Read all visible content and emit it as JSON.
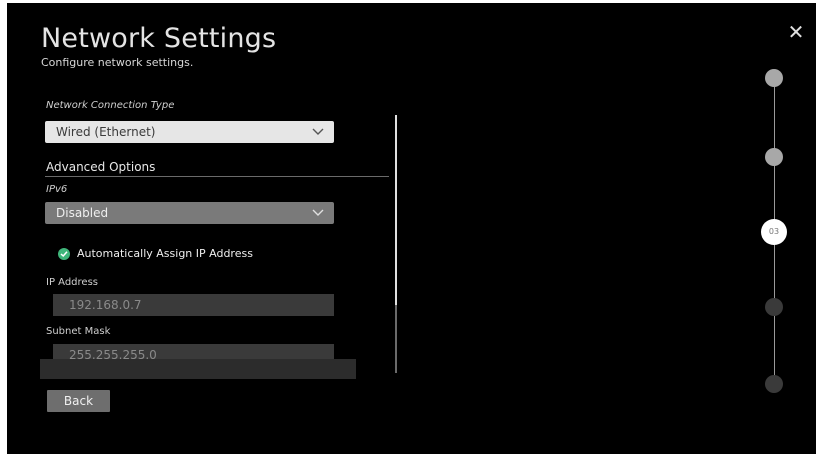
{
  "header": {
    "title": "Network Settings",
    "subtitle": "Configure network settings.",
    "close_icon": "close-icon",
    "close_glyph": "✕"
  },
  "form": {
    "connection_type_label": "Network Connection Type",
    "connection_type_value": "Wired (Ethernet)",
    "advanced_options_label": "Advanced Options",
    "ipv6_label": "IPv6",
    "ipv6_value": "Disabled",
    "auto_assign_label": "Automatically Assign IP Address",
    "ip_address_label": "IP Address",
    "ip_address_value": "192.168.0.7",
    "subnet_mask_label": "Subnet Mask",
    "subnet_mask_value": "255.255.255.0",
    "back_button_label": "Back"
  },
  "stepper": {
    "current_step_label": "03",
    "steps": [
      {
        "state": "done"
      },
      {
        "state": "done"
      },
      {
        "state": "current"
      },
      {
        "state": "future"
      },
      {
        "state": "future"
      }
    ]
  },
  "colors": {
    "background": "#000000",
    "check_green": "#3fb57a",
    "select_light": "#e6e6e6",
    "select_gray": "#7a7a7a"
  }
}
